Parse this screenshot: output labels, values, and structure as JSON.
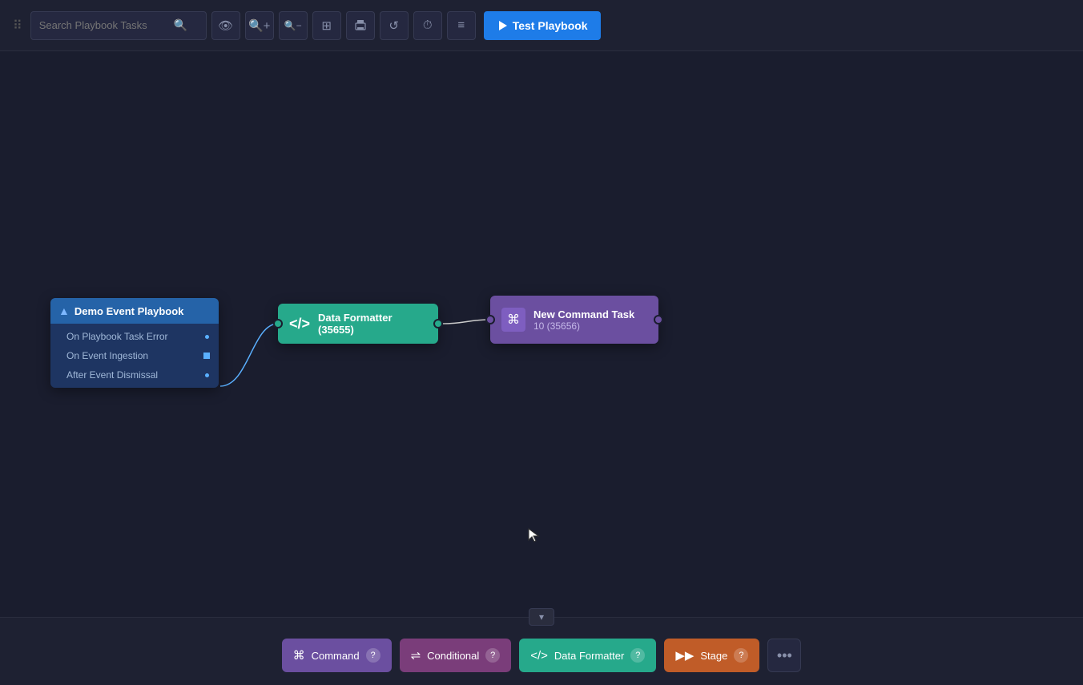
{
  "toolbar": {
    "search_placeholder": "Search Playbook Tasks",
    "test_playbook_label": "Test Playbook",
    "drag_handle": "⠿",
    "zoom_in": "+",
    "zoom_out": "−",
    "fit": "⊞",
    "print": "🖨",
    "refresh": "↺",
    "history": "⏱",
    "menu": "≡",
    "eye": "👁"
  },
  "nodes": {
    "playbook": {
      "title": "Demo Event Playbook",
      "rows": [
        {
          "label": "On Playbook Task Error",
          "connector": "dot"
        },
        {
          "label": "On Event Ingestion",
          "connector": "square"
        },
        {
          "label": "After Event Dismissal",
          "connector": "dot"
        }
      ]
    },
    "formatter": {
      "label": "Data Formatter (35655)"
    },
    "command": {
      "line1": "New Command Task",
      "line2": "10 (35656)"
    }
  },
  "bottom_panel": {
    "collapse_icon": "▾",
    "buttons": [
      {
        "id": "command",
        "label": "Command",
        "icon": "⌘",
        "color": "#6b4fa0"
      },
      {
        "id": "conditional",
        "label": "Conditional",
        "icon": "↔",
        "color": "#7a3d7a"
      },
      {
        "id": "formatter",
        "label": "Data Formatter",
        "icon": "</>",
        "color": "#26a98b"
      },
      {
        "id": "stage",
        "label": "Stage",
        "icon": "▶▶",
        "color": "#c05c28"
      }
    ],
    "more_label": "•••"
  }
}
